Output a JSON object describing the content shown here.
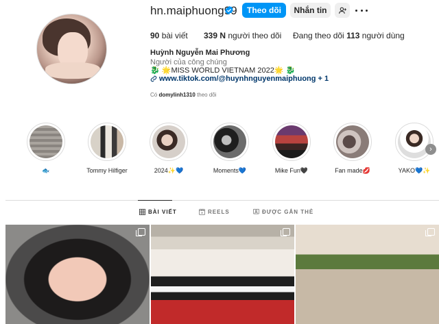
{
  "profile": {
    "username": "hn.maiphuong99",
    "follow_label": "Theo dõi",
    "message_label": "Nhắn tin",
    "posts_count": "90",
    "posts_label": "bài viết",
    "followers_count": "339 N",
    "followers_label": "người theo dõi",
    "following_prefix": "Đang theo dõi",
    "following_count": "113",
    "following_suffix": "người dùng",
    "full_name": "Huỳnh Nguyễn Mai Phương",
    "category": "Người của công chúng",
    "bio_line": "🐉 🌟MISS WORLD VIETNAM 2022🌟 🐉",
    "link_text": "www.tiktok.com/@huynhnguyenmaiphuong + 1",
    "followed_by_prefix": "Có",
    "followed_by_user": "domylinh1310",
    "followed_by_suffix": "theo dõi"
  },
  "highlights": [
    {
      "label": "🐟"
    },
    {
      "label": "Tommy Hilfiger"
    },
    {
      "label": "2024✨💙"
    },
    {
      "label": "Moments💙"
    },
    {
      "label": "Mike Fun🖤"
    },
    {
      "label": "Fan made💋"
    },
    {
      "label": "YAKO💙✨"
    }
  ],
  "tabs": [
    {
      "label": "BÀI VIẾT",
      "icon": "grid-icon"
    },
    {
      "label": "REELS",
      "icon": "reels-icon"
    },
    {
      "label": "ĐƯỢC GẮN THẺ",
      "icon": "tagged-icon"
    }
  ],
  "colors": {
    "accent": "#0095f6",
    "verified": "#0095f6",
    "link": "#00376b",
    "secondary_text": "#737373"
  }
}
